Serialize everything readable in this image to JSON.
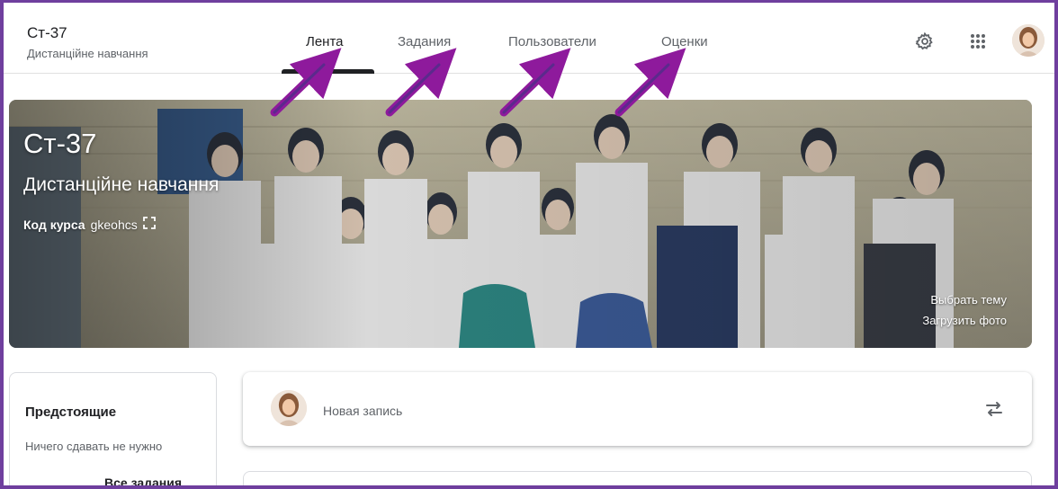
{
  "header": {
    "class_name": "Ст-37",
    "class_subtitle": "Дистанційне навчання",
    "tabs": [
      {
        "label": "Лента",
        "active": true
      },
      {
        "label": "Задания",
        "active": false
      },
      {
        "label": "Пользователи",
        "active": false
      },
      {
        "label": "Оценки",
        "active": false
      }
    ],
    "icons": [
      "gear-icon",
      "apps-grid-icon",
      "user-avatar"
    ]
  },
  "banner": {
    "title": "Ст-37",
    "subtitle": "Дистанційне навчання",
    "code_label": "Код курса",
    "code_value": "gkeohcs",
    "choose_theme": "Выбрать тему",
    "upload_photo": "Загрузить фото"
  },
  "upcoming": {
    "title": "Предстоящие",
    "empty_text": "Ничего сдавать не нужно",
    "all_link": "Все задания"
  },
  "stream": {
    "new_post_placeholder": "Новая запись"
  },
  "colors": {
    "accent_arrow": "#8e1a9c",
    "frame": "#6f3f9e",
    "active_tab_indicator": "#202124"
  }
}
